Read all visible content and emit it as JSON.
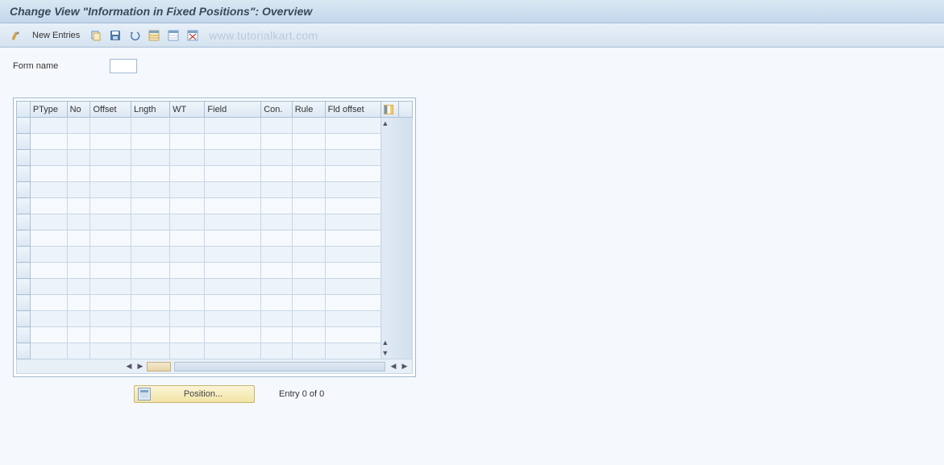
{
  "title": "Change View \"Information in Fixed Positions\": Overview",
  "toolbar": {
    "new_entries": "New Entries",
    "watermark": "www.tutorialkart.com"
  },
  "form": {
    "name_label": "Form name",
    "name_value": ""
  },
  "table": {
    "columns": {
      "ptype": "PType",
      "no": "No",
      "offset": "Offset",
      "lngth": "Lngth",
      "wt": "WT",
      "field": "Field",
      "con": "Con.",
      "rule": "Rule",
      "fld_offset": "Fld offset"
    },
    "row_count": 15
  },
  "footer": {
    "position_label": "Position...",
    "entry_text": "Entry 0 of 0"
  }
}
